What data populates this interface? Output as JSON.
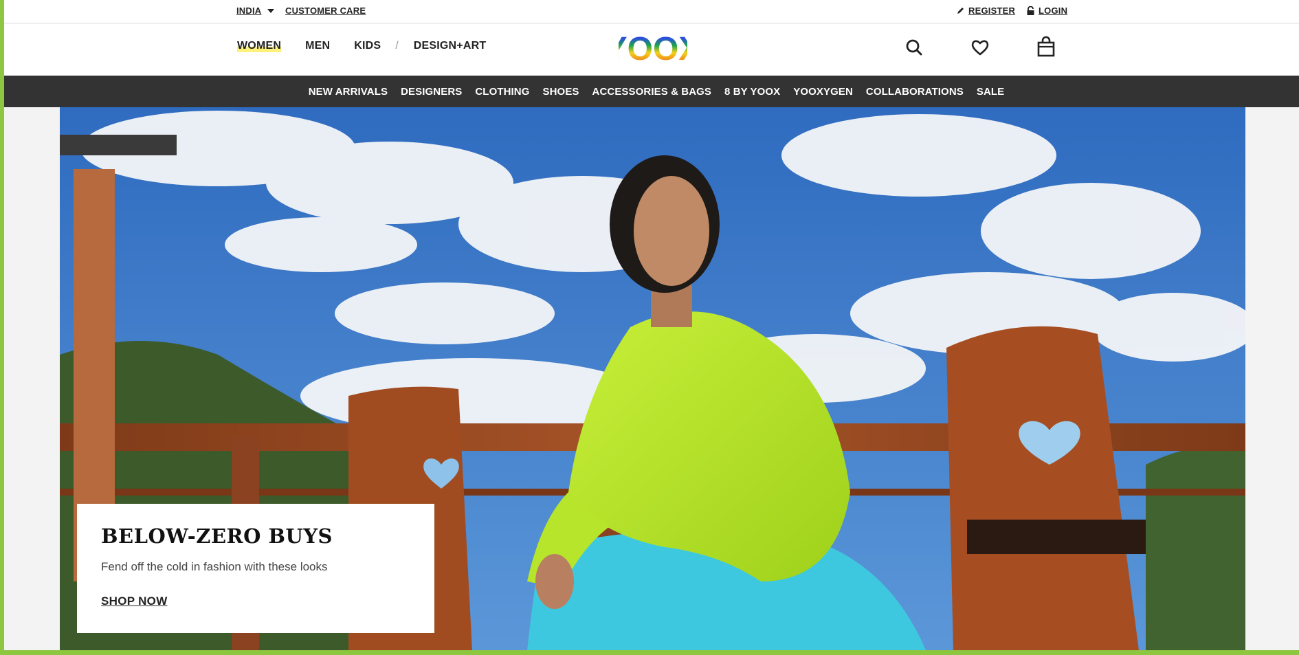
{
  "utility": {
    "country": "INDIA",
    "customer_care": "CUSTOMER CARE",
    "register": "REGISTER",
    "login": "LOGIN"
  },
  "header": {
    "gender_nav": [
      {
        "label": "WOMEN",
        "active": true
      },
      {
        "label": "MEN"
      },
      {
        "label": "KIDS"
      }
    ],
    "separator": "/",
    "design_art": "DESIGN+ART",
    "logo_text": "YOOX",
    "icons": [
      "search-icon",
      "wishlist-heart-icon",
      "shopping-bag-icon"
    ]
  },
  "category_nav": [
    "NEW ARRIVALS",
    "DESIGNERS",
    "CLOTHING",
    "SHOES",
    "ACCESSORIES & BAGS",
    "8 BY YOOX",
    "YOOXYGEN",
    "COLLABORATIONS",
    "SALE"
  ],
  "hero": {
    "title": "BELOW-ZERO BUYS",
    "subtitle": "Fend off the cold in fashion with these looks",
    "cta": "SHOP NOW"
  },
  "colors": {
    "frame_green": "#8dc63f",
    "nav_bar": "#333333",
    "active_highlight": "#fff27a",
    "sweater": "#b5e61d",
    "trousers": "#3ec8e0",
    "wood": "#9a4a22"
  }
}
